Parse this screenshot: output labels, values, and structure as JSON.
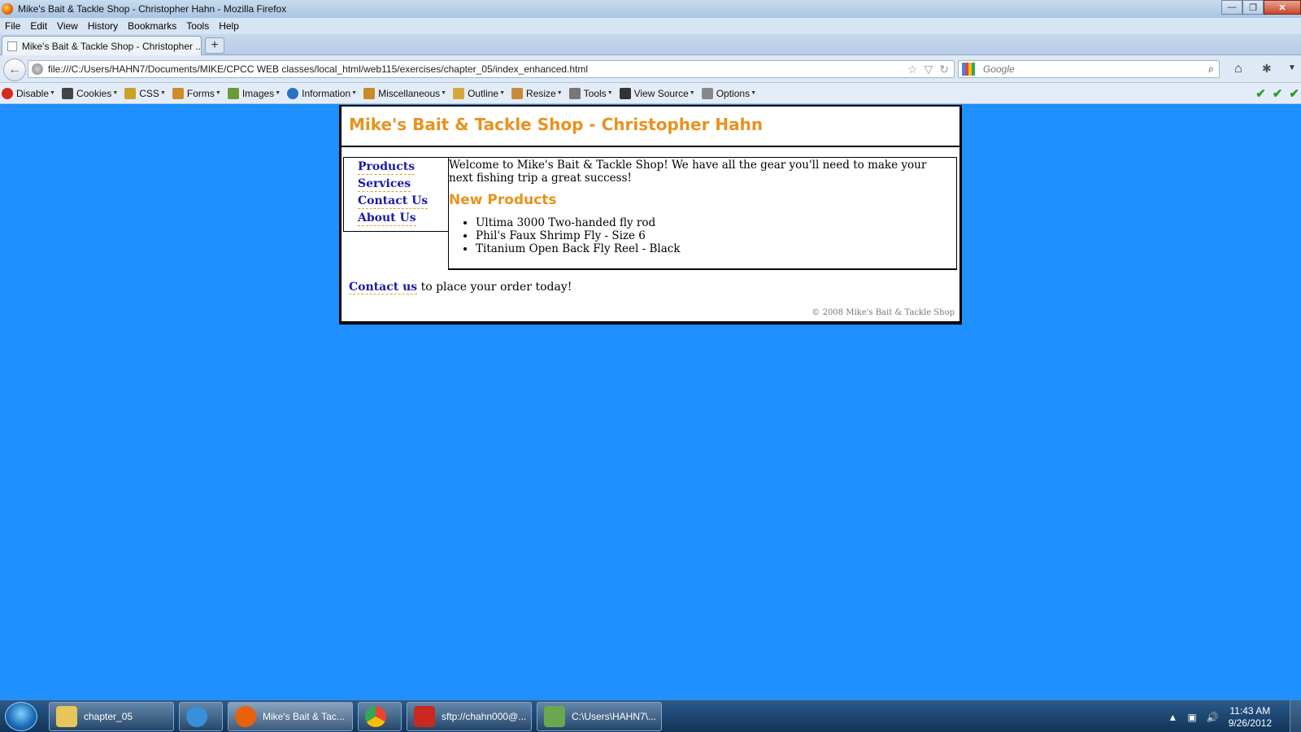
{
  "window": {
    "title": "Mike's Bait & Tackle Shop - Christopher Hahn - Mozilla Firefox",
    "controls": {
      "minimize": "—",
      "maximize": "❐",
      "close": "✕"
    }
  },
  "menubar": {
    "items": [
      "File",
      "Edit",
      "View",
      "History",
      "Bookmarks",
      "Tools",
      "Help"
    ]
  },
  "tabs": {
    "active_label": "Mike's Bait & Tackle Shop - Christopher ...",
    "new_tab": "+"
  },
  "navbar": {
    "back": "←",
    "url": "file:///C:/Users/HAHN7/Documents/MIKE/CPCC WEB classes/local_html/web115/exercises/chapter_05/index_enhanced.html",
    "search_placeholder": "Google",
    "star": "☆",
    "dropdown": "▽",
    "reload": "↻",
    "magnifier": "⌕",
    "home": "⌂",
    "addon": "✱",
    "menu": "▼"
  },
  "devbar": {
    "items": [
      {
        "label": "Disable",
        "icon": "disable-icon",
        "color": "#d62a1e"
      },
      {
        "label": "Cookies",
        "icon": "cookies-icon",
        "color": "#444444"
      },
      {
        "label": "CSS",
        "icon": "css-icon",
        "color": "#c9a227"
      },
      {
        "label": "Forms",
        "icon": "forms-icon",
        "color": "#d08c2a"
      },
      {
        "label": "Images",
        "icon": "images-icon",
        "color": "#6a9a3a"
      },
      {
        "label": "Information",
        "icon": "information-icon",
        "color": "#2a6fc8"
      },
      {
        "label": "Miscellaneous",
        "icon": "miscellaneous-icon",
        "color": "#c98a2a"
      },
      {
        "label": "Outline",
        "icon": "outline-icon",
        "color": "#d4a83a"
      },
      {
        "label": "Resize",
        "icon": "resize-icon",
        "color": "#c88a3a"
      },
      {
        "label": "Tools",
        "icon": "tools-icon",
        "color": "#777777"
      },
      {
        "label": "View Source",
        "icon": "view-source-icon",
        "color": "#333333"
      },
      {
        "label": "Options",
        "icon": "options-icon",
        "color": "#888888"
      }
    ],
    "checks": [
      "✔",
      "✔",
      "✔"
    ]
  },
  "site": {
    "title": "Mike's Bait & Tackle Shop - Christopher Hahn",
    "nav": [
      "Products",
      "Services",
      "Contact Us",
      "About Us"
    ],
    "welcome": "Welcome to Mike's Bait & Tackle Shop! We have all the gear you'll need to make your next fishing trip a great success!",
    "new_products_heading": "New Products",
    "products": [
      "Ultima 3000 Two-handed fly rod",
      "Phil's Faux Shrimp Fly - Size 6",
      "Titanium Open Back Fly Reel - Black"
    ],
    "footer_link": "Contact us",
    "footer_text": " to place your order today!",
    "copyright": "© 2008 Mike's Bait & Tackle Shop",
    "colors": {
      "heading": "#e8921e",
      "link": "#1a1aa6",
      "background": "#1e90ff"
    }
  },
  "taskbar": {
    "tasks": [
      {
        "label": "chapter_05",
        "icon": "folder-icon",
        "color": "#e8c55a"
      },
      {
        "label": "",
        "icon": "internet-explorer-icon",
        "color": "#3a8fd8"
      },
      {
        "label": "Mike's Bait & Tac...",
        "icon": "firefox-icon",
        "color": "#e8620c"
      },
      {
        "label": "",
        "icon": "chrome-icon",
        "color": "#34a853"
      },
      {
        "label": "sftp://chahn000@...",
        "icon": "filezilla-icon",
        "color": "#c8281e"
      },
      {
        "label": "C:\\Users\\HAHN7\\...",
        "icon": "notepad-icon",
        "color": "#6aa84f"
      }
    ],
    "clock_time": "11:43 AM",
    "clock_date": "9/26/2012",
    "tray_arrow": "▲",
    "network": "▣",
    "volume": "🔊"
  }
}
